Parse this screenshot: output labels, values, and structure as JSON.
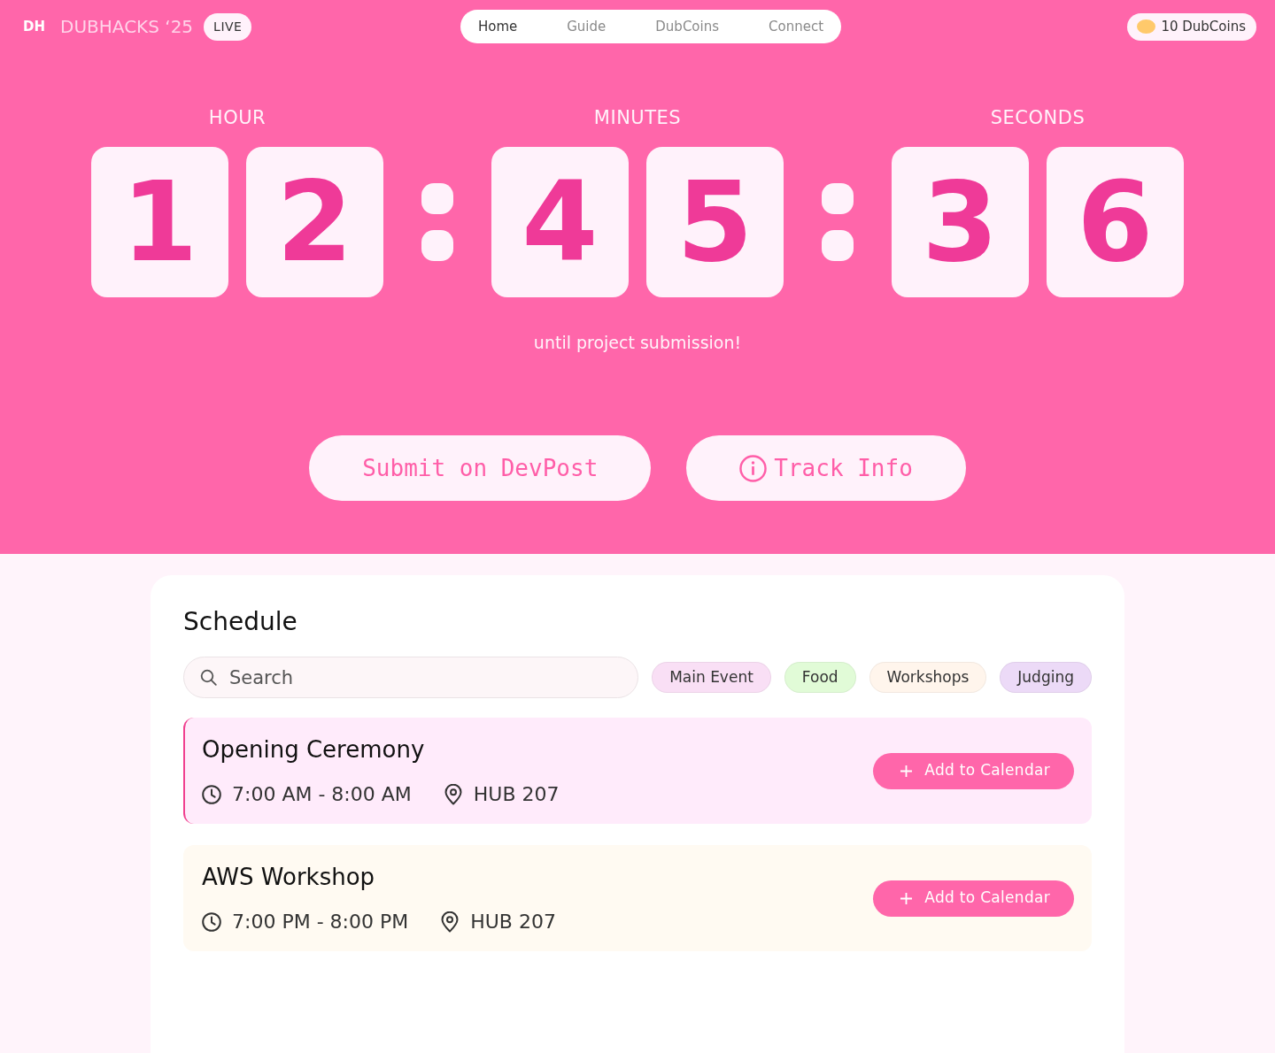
{
  "header": {
    "logo": "DH",
    "title": "DUBHACKS ‘25",
    "badge": "LIVE",
    "nav": [
      {
        "label": "Home",
        "selected": true
      },
      {
        "label": "Guide",
        "selected": false
      },
      {
        "label": "DubCoins",
        "selected": false
      },
      {
        "label": "Connect",
        "selected": false
      }
    ],
    "coins": "10 DubCoins"
  },
  "countdown": {
    "units": [
      {
        "label": "HOUR",
        "digits": [
          "1",
          "2"
        ]
      },
      {
        "label": "MINUTES",
        "digits": [
          "4",
          "5"
        ]
      },
      {
        "label": "SECONDS",
        "digits": [
          "3",
          "6"
        ]
      }
    ],
    "caption": "until project submission!"
  },
  "actions": [
    {
      "label": "Submit on DevPost",
      "kind": "link"
    },
    {
      "label": "Track Info",
      "kind": "info"
    }
  ],
  "schedule": {
    "title": "Schedule",
    "search": {
      "placeholder": "Search"
    },
    "filters": [
      {
        "label": "Main Event",
        "color": "#f9dff5"
      },
      {
        "label": "Food",
        "color": "#e1fbd7"
      },
      {
        "label": "Workshops",
        "color": "#fff5ec"
      },
      {
        "label": "Judging",
        "color": "#ecdaf7"
      }
    ],
    "events": [
      {
        "title": "Opening Ceremony",
        "time": "7:00 AM - 8:00 AM",
        "location": "HUB 207",
        "color": "#ffebfb",
        "current": true,
        "button": "Add to Calendar"
      },
      {
        "title": "AWS Workshop",
        "time": "7:00 PM - 8:00 PM",
        "location": "HUB 207",
        "color": "#fffaf2",
        "current": false,
        "button": "Add to Calendar"
      }
    ]
  }
}
